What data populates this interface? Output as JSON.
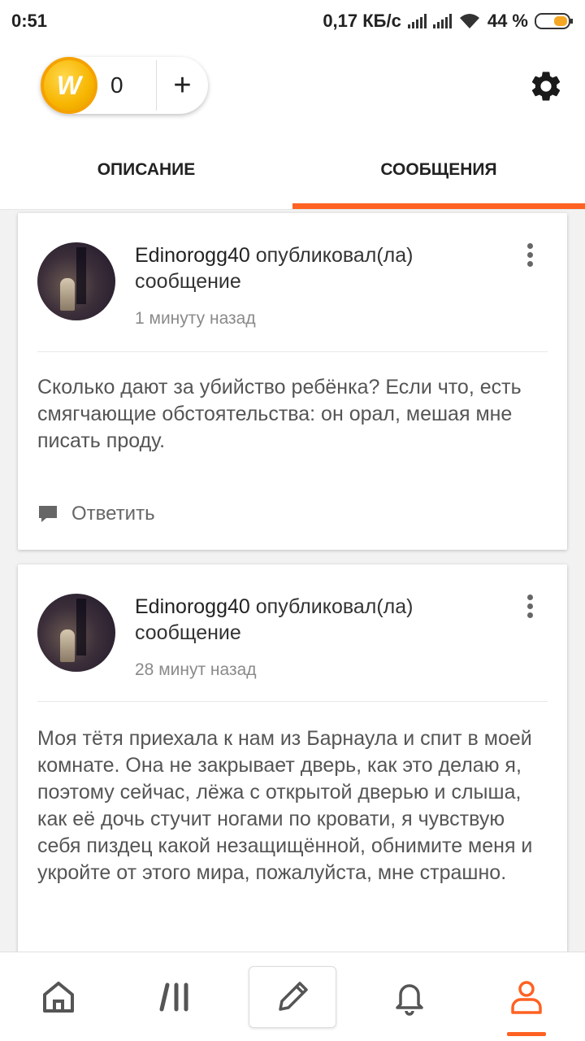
{
  "status_bar": {
    "time": "0:51",
    "speed": "0,17 КБ/с",
    "battery": "44 %",
    "battery_level": 0.44
  },
  "header": {
    "coin_count": "0",
    "add_label": "+",
    "settings_icon": "gear-icon"
  },
  "tabs": [
    {
      "label": "ОПИСАНИЕ",
      "active": false
    },
    {
      "label": "СООБЩЕНИЯ",
      "active": true
    }
  ],
  "posts": [
    {
      "author": "Edinorogg40",
      "action": "опубликовал(ла) сообщение",
      "time": "1 минуту назад",
      "text": "Сколько дают за убийство ребёнка? Если что, есть смягчающие обстоятельства: он орал, мешая мне писать проду.",
      "reply_label": "Ответить"
    },
    {
      "author": "Edinorogg40",
      "action": "опубликовал(ла) сообщение",
      "time": "28 минут назад",
      "text": "Моя тётя приехала к нам из Барнаула и спит в моей комнате. Она не закрывает дверь, как это делаю я, поэтому сейчас, лёжа с открытой дверью и слыша, как её дочь стучит ногами по кровати, я чувствую себя пиздец какой незащищённой, обнимите меня и укройте от этого мира, пожалуйста, мне страшно."
    }
  ],
  "bottom_nav": {
    "items": [
      "home-icon",
      "library-icon",
      "write-icon",
      "bell-icon",
      "profile-icon"
    ],
    "active": "profile-icon"
  },
  "colors": {
    "accent": "#ff6122",
    "coin": "#f7b500"
  }
}
